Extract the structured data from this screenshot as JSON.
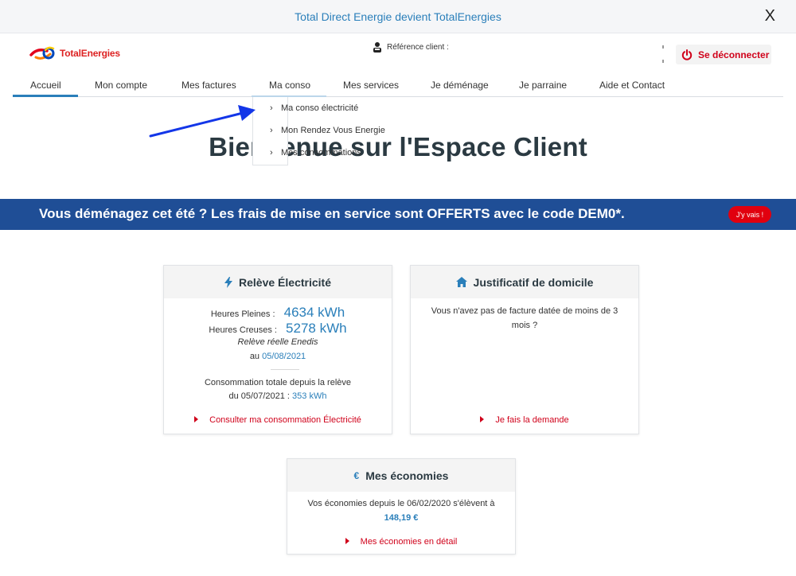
{
  "announcement": {
    "text": "Total Direct Energie devient TotalEnergies",
    "close_label": "X"
  },
  "header": {
    "logo_text": "TotalEnergies",
    "reference_label": "Référence client :",
    "logout_label": "Se déconnecter"
  },
  "nav": {
    "items": [
      {
        "label": "Accueil"
      },
      {
        "label": "Mon compte"
      },
      {
        "label": "Mes factures"
      },
      {
        "label": "Ma conso"
      },
      {
        "label": "Mes services"
      },
      {
        "label": "Je déménage"
      },
      {
        "label": "Je parraine"
      },
      {
        "label": "Aide et Contact"
      }
    ],
    "active": "Accueil"
  },
  "dropdown": {
    "items": [
      {
        "label": "Ma conso électricité"
      },
      {
        "label": "Mon Rendez Vous Energie"
      },
      {
        "label": "Mes consommations"
      }
    ]
  },
  "welcome": {
    "title": "Bienvenue sur l'Espace Client"
  },
  "promo": {
    "text": "Vous déménagez cet été ? Les frais de mise en service sont OFFERTS avec le code DEM0*.",
    "button_label": "J'y vais !"
  },
  "cards": {
    "releve": {
      "title": "Relève Électricité",
      "hp_label": "Heures Pleines :",
      "hp_value": "4634 kWh",
      "hc_label": "Heures Creuses :",
      "hc_value": "5278 kWh",
      "releve_type": "Relève réelle Enedis",
      "date_prefix": "au",
      "date": "05/08/2021",
      "conso_line1": "Consommation totale depuis la relève",
      "conso_prefix": "du 05/07/2021 :",
      "conso_value": "353 kWh",
      "link": "Consulter ma consommation Électricité"
    },
    "justificatif": {
      "title": "Justificatif de domicile",
      "line1": "Vous n'avez pas de facture datée de moins de 3",
      "line2": "mois ?",
      "link": "Je fais la demande"
    },
    "economies": {
      "title": "Mes économies",
      "line1": "Vos économies depuis le 06/02/2020 s'élèvent à",
      "amount": "148,19 €",
      "link": "Mes économies en détail"
    }
  },
  "colors": {
    "brand_blue": "#2a7fba",
    "promo_bg": "#1f4e96",
    "accent_red": "#d0021b",
    "arrow": "#1336e8"
  }
}
